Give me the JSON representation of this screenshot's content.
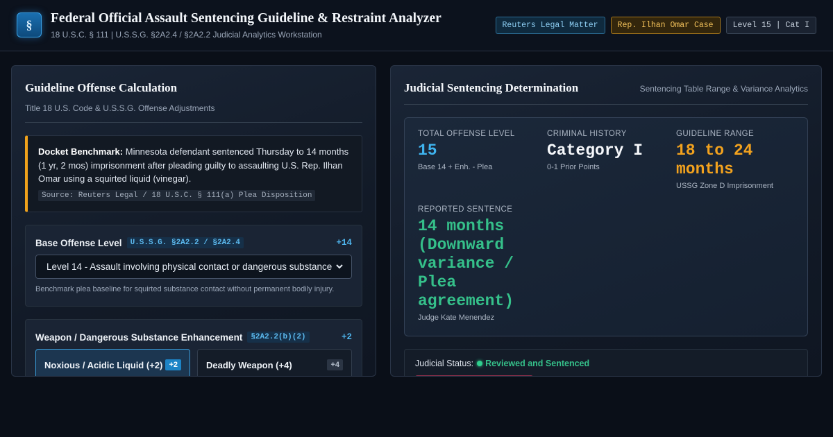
{
  "header": {
    "logo_glyph": "§",
    "title": "Federal Official Assault Sentencing Guideline & Restraint Analyzer",
    "subtitle": "18 U.S.C. § 111 | U.S.S.G. §2A2.4 / §2A2.2 Judicial Analytics Workstation",
    "badges": [
      {
        "label": "Reuters Legal Matter",
        "tone": "blue"
      },
      {
        "label": "Rep. Ilhan Omar Case",
        "tone": "amber"
      },
      {
        "label": "Level 15 | Cat I",
        "tone": "gray"
      }
    ]
  },
  "left_panel": {
    "title": "Guideline Offense Calculation",
    "subtitle": "Title 18 U.S. Code & U.S.S.G. Offense Adjustments",
    "docket": {
      "label": "Docket Benchmark:",
      "text": "Minnesota defendant sentenced Thursday to 14 months (1 yr, 2 mos) imprisonment after pleading guilty to assaulting U.S. Rep. Ilhan Omar using a squirted liquid (vinegar).",
      "source": "Source: Reuters Legal / 18 U.S.C. § 111(a) Plea Disposition",
      "accent_color": "#f0a21b"
    },
    "base_offense": {
      "title": "Base Offense Level",
      "chip": "U.S.S.G. §2A2.2 / §2A2.4",
      "delta": "+14",
      "selected_option": "Level 14 - Assault involving physical contact or dangerous substance",
      "note": "Benchmark plea baseline for squirted substance contact without permanent bodily injury."
    },
    "weapon_enhancement": {
      "title": "Weapon / Dangerous Substance Enhancement",
      "chip": "§2A2.2(b)(2)",
      "delta": "+2",
      "options": [
        {
          "label": "Noxious / Acidic Liquid (+2)",
          "tag": "+2",
          "selected": true
        },
        {
          "label": "Deadly Weapon (+4)",
          "tag": "+4",
          "selected": false
        }
      ]
    }
  },
  "right_panel": {
    "title": "Judicial Sentencing Determination",
    "subtitle": "Sentencing Table Range & Variance Analytics",
    "metrics": {
      "total_offense": {
        "label": "TOTAL OFFENSE LEVEL",
        "value": "15",
        "note": "Base 14 + Enh. - Plea"
      },
      "criminal_history": {
        "label": "CRIMINAL HISTORY",
        "value": "Category I",
        "note": "0-1 Prior Points"
      },
      "guideline_range": {
        "label": "GUIDELINE RANGE",
        "value": "18 to 24 months",
        "note": "USSG Zone D Imprisonment"
      },
      "reported_sentence": {
        "label": "REPORTED SENTENCE",
        "value": "14 months (Downward variance / Plea agreement)",
        "note": "Judge Kate Menendez"
      }
    },
    "status": {
      "label": "Judicial Status:",
      "value": "Reviewed and Sentenced"
    }
  },
  "colors": {
    "background": "#0a0f18",
    "accent_blue": "#3fb4ef",
    "accent_amber": "#f2a21e",
    "accent_green": "#35c08a"
  }
}
